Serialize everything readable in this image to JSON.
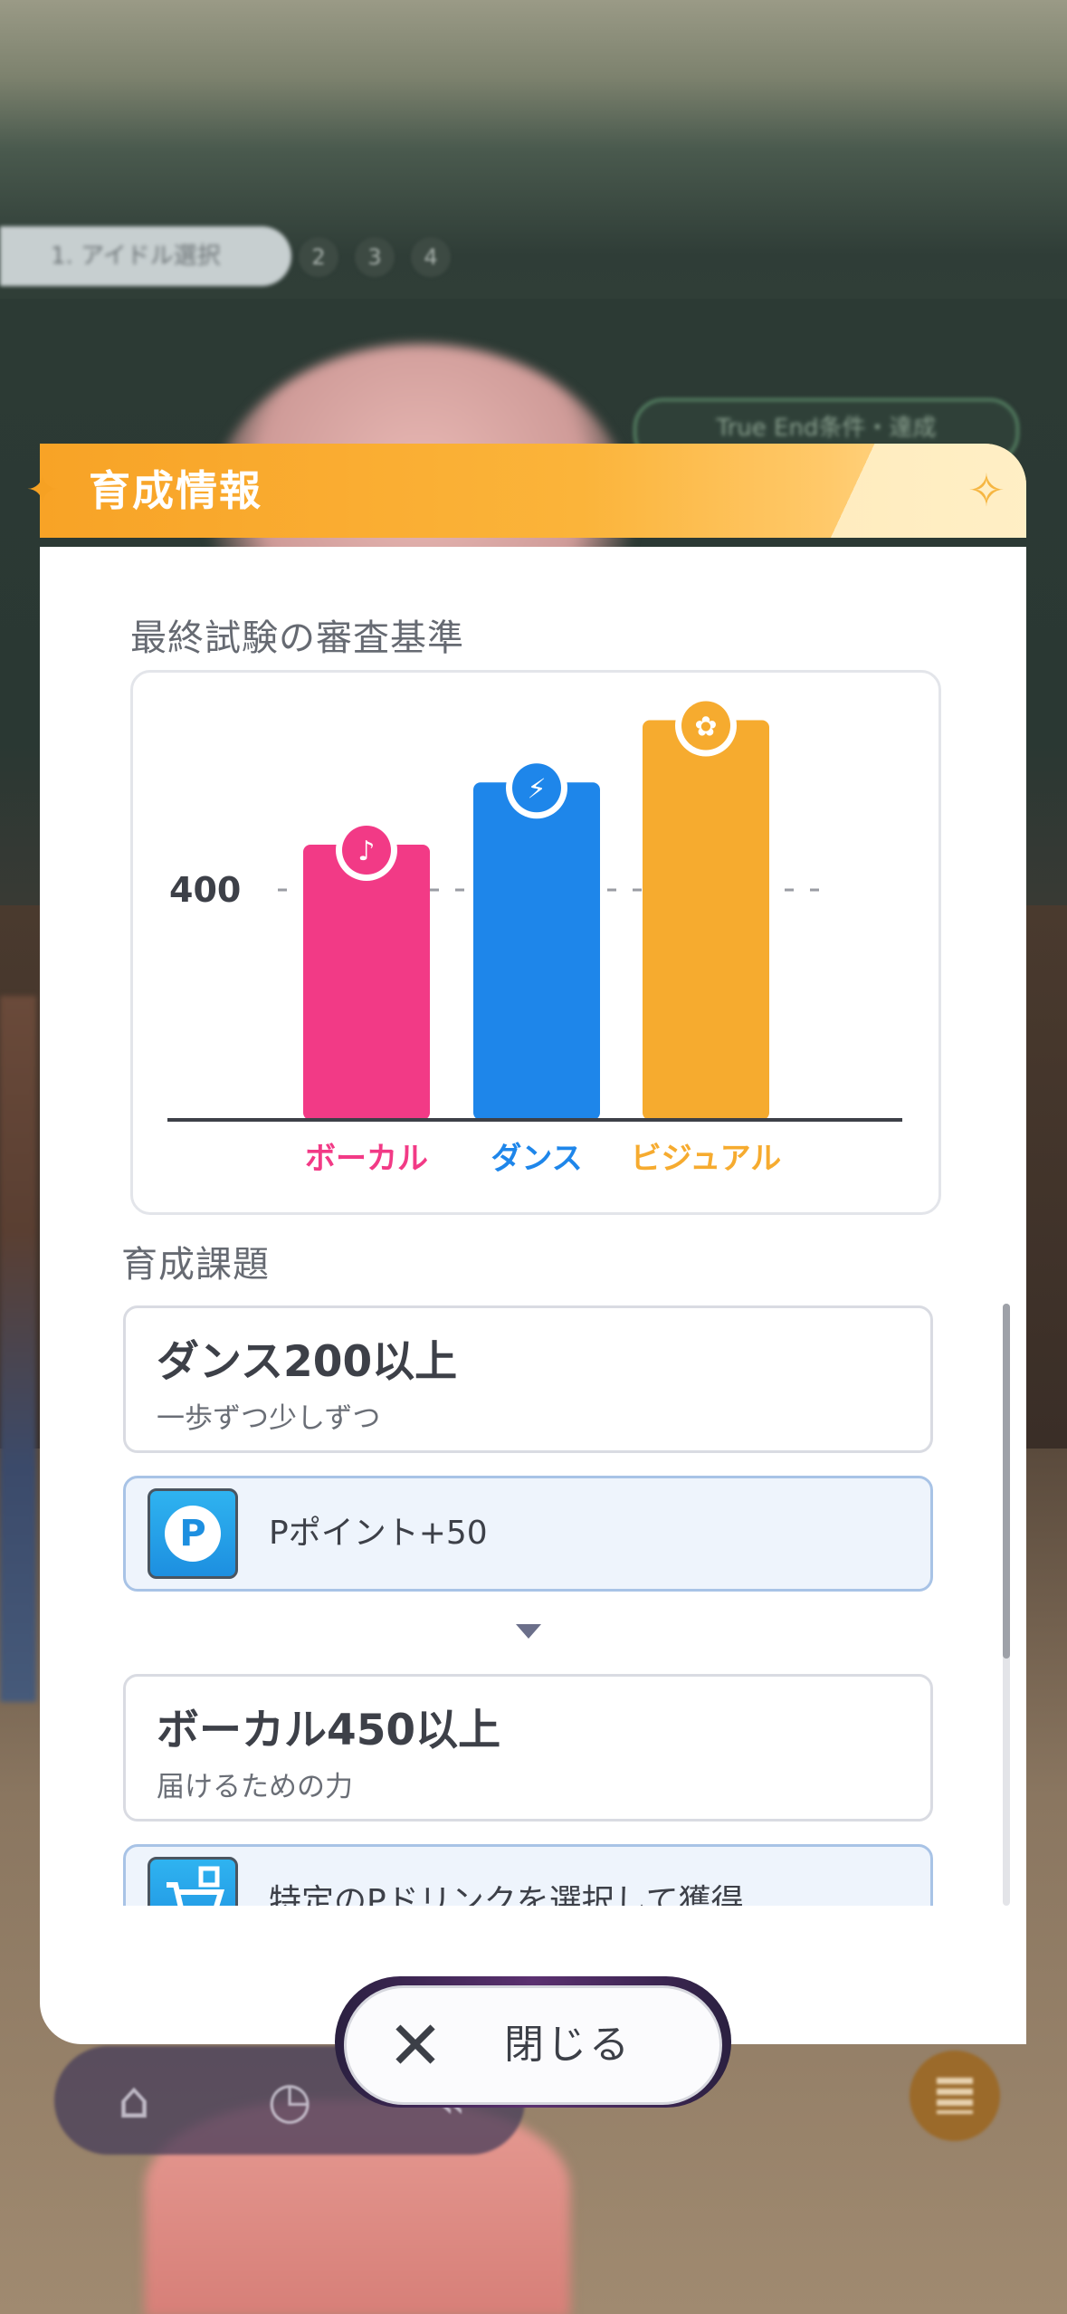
{
  "background": {
    "step_label": "1. アイドル選択",
    "steps": [
      "2",
      "3",
      "4"
    ],
    "true_end_label": "True End条件・達成"
  },
  "modal": {
    "title": "育成情報",
    "exam_section_title": "最終試験の審査基準",
    "tasks_section_title": "育成課題",
    "close_label": "閉じる"
  },
  "chart_data": {
    "type": "bar",
    "categories": [
      "ボーカル",
      "ダンス",
      "ビジュアル"
    ],
    "values": [
      480,
      590,
      700
    ],
    "reference_line": {
      "value": 400,
      "label": "400"
    },
    "ylim": [
      0,
      720
    ],
    "colors": [
      "#f23a86",
      "#1e86ea",
      "#f6ab2f"
    ],
    "icons": [
      "microphone-icon",
      "dance-shoe-icon",
      "visual-icon"
    ]
  },
  "tasks": [
    {
      "title": "ダンス200以上",
      "subtitle": "一歩ずつ少しずつ",
      "reward": {
        "icon": "p-point-icon",
        "icon_letter": "P",
        "text": "Pポイント+50"
      }
    },
    {
      "title": "ボーカル450以上",
      "subtitle": "届けるための力",
      "reward": {
        "icon": "cart-icon",
        "text": "特定のPドリンクを選択して獲得"
      }
    }
  ],
  "scroll_fraction": 0.59,
  "nav_icons": [
    "home-icon",
    "clock-icon",
    "back-icon",
    "menu-icon"
  ]
}
